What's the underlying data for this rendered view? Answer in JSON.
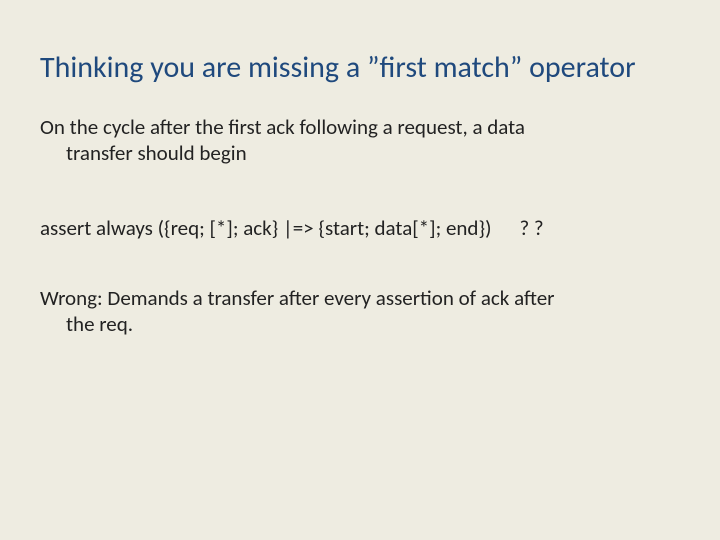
{
  "title": "Thinking you are missing a ”first match” operator",
  "desc_line1": "On the cycle after the first ack following a request, a data",
  "desc_line2": "transfer should begin",
  "code_main": "assert always  ({req; [*]; ack} |=> {start; data[*];  end})",
  "code_qq": "? ?",
  "wrong_line1": "Wrong:   Demands  a transfer after every assertion of ack after",
  "wrong_line2": "the req."
}
